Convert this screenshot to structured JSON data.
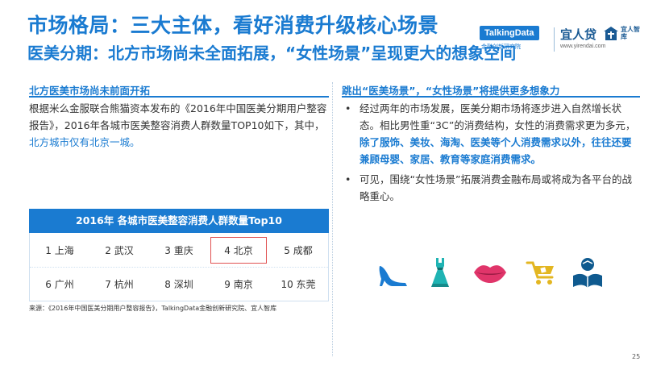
{
  "header": {
    "title": "市场格局：三大主体，看好消费升级核心场景",
    "subtitle": "医美分期：北方市场尚未全面拓展，“女性场景”呈现更大的想象空间"
  },
  "logos": {
    "talkingdata": "TalkingData",
    "talkingdata_sub": "金融创新研究院",
    "yirendai": "宜人贷",
    "yirendai_tag": "宜人智库",
    "yirendai_url": "www.yirendai.com"
  },
  "left": {
    "heading": "北方医美市场尚未前面开拓",
    "para_main": "根据米么金服联合熊猫资本发布的《2016年中国医美分期用户整容报告》，2016年各城市医美整容消费人群数量TOP10如下，其中，",
    "para_highlight": "北方城市仅有北京一城。"
  },
  "table": {
    "title": "2016年 各城市医美整容消费人群数量Top10",
    "rows": [
      [
        "1 上海",
        "2 武汉",
        "3 重庆",
        "4 北京",
        "5 成都"
      ],
      [
        "6 广州",
        "7 杭州",
        "8 深圳",
        "9 南京",
        "10 东莞"
      ]
    ],
    "highlighted": "4 北京"
  },
  "right": {
    "heading": "跳出“医美场景”，“女性场景”将提供更多想象力",
    "bullet_symbol": "•",
    "bullet1_main": "经过两年的市场发展，医美分期市场将逐步进入自然增长状态。相比男性重“3C”的消费结构，女性的消费需求更为多元，",
    "bullet1_highlight": "除了服饰、美妆、海淘、医美等个人消费需求以外，往往还要兼顾母婴、家居、教育等家庭消费需求。",
    "bullet2": "可见，围绕“女性场景”拓展消费金融布局或将成为各平台的战略重心。"
  },
  "icons": [
    "high-heel-icon",
    "dress-icon",
    "lips-icon",
    "shopping-cart-icon",
    "education-icon"
  ],
  "colors": {
    "accent": "#1a7bd1",
    "highlight_border": "#e05252"
  },
  "source": "来源：《2016年中国医美分期用户整容报告》，TalkingData金融创新研究院、宜人智库",
  "page_number": "25"
}
